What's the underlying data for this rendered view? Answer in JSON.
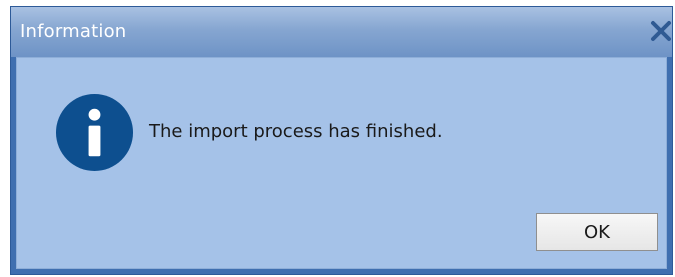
{
  "window": {
    "title": "Information",
    "close_icon": "close-icon"
  },
  "content": {
    "icon": "info-icon",
    "message": "The import process has finished."
  },
  "buttons": {
    "ok_label": "OK"
  },
  "colors": {
    "titlebar": "#86a6d1",
    "client_background": "#a5c2e8",
    "icon_circle": "#0d4f8f",
    "close_icon": "#2f5a93"
  }
}
